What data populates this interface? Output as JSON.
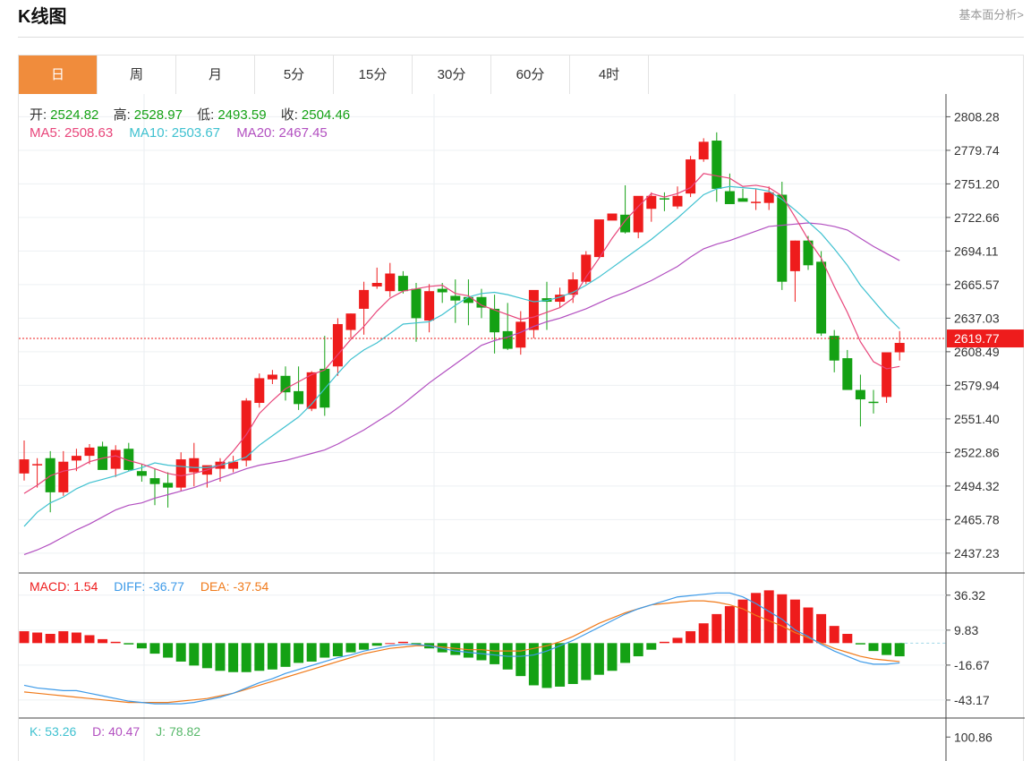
{
  "header": {
    "title": "K线图",
    "link": "基本面分析>"
  },
  "tabs": [
    "日",
    "周",
    "月",
    "5分",
    "15分",
    "30分",
    "60分",
    "4时"
  ],
  "active_tab": 0,
  "ohlc": {
    "open_label": "开:",
    "open": "2524.82",
    "high_label": "高:",
    "high": "2528.97",
    "low_label": "低:",
    "low": "2493.59",
    "close_label": "收:",
    "close": "2504.46"
  },
  "ma": {
    "ma5_label": "MA5:",
    "ma5": "2508.63",
    "ma10_label": "MA10:",
    "ma10": "2503.67",
    "ma20_label": "MA20:",
    "ma20": "2467.45"
  },
  "macd": {
    "macd_label": "MACD:",
    "macd": "1.54",
    "diff_label": "DIFF:",
    "diff": "-36.77",
    "dea_label": "DEA:",
    "dea": "-37.54"
  },
  "kdj": {
    "k_label": "K:",
    "k": "53.26",
    "d_label": "D:",
    "d": "40.47",
    "j_label": "J:",
    "j": "78.82"
  },
  "colors": {
    "up": "#ee1c1c",
    "down": "#14a114",
    "ma5": "#e8457a",
    "ma10": "#3fc1d0",
    "ma20": "#b24fc0",
    "diff": "#3d9ae8",
    "dea": "#f07a1a",
    "tab_active": "#f08c3c"
  },
  "chart_data": [
    {
      "type": "candlestick",
      "title": "",
      "y_ticks": [
        "2808.28",
        "2779.74",
        "2751.20",
        "2722.66",
        "2694.11",
        "2665.57",
        "2637.03",
        "2608.49",
        "2579.94",
        "2551.40",
        "2522.86",
        "2494.32",
        "2465.78",
        "2437.23"
      ],
      "ylim": [
        2428,
        2820
      ],
      "current_price": "2619.77",
      "candles": [
        [
          2505,
          2533,
          2499,
          2517
        ],
        [
          2513,
          2518,
          2493,
          2513
        ],
        [
          2518,
          2524,
          2472,
          2489
        ],
        [
          2489,
          2524,
          2486,
          2515
        ],
        [
          2516,
          2526,
          2507,
          2520
        ],
        [
          2520,
          2530,
          2513,
          2527
        ],
        [
          2528,
          2532,
          2510,
          2508
        ],
        [
          2509,
          2529,
          2502,
          2525
        ],
        [
          2526,
          2531,
          2507,
          2508
        ],
        [
          2507,
          2513,
          2498,
          2503
        ],
        [
          2501,
          2509,
          2478,
          2496
        ],
        [
          2497,
          2506,
          2476,
          2493
        ],
        [
          2493,
          2523,
          2490,
          2517
        ],
        [
          2506,
          2531,
          2494,
          2518
        ],
        [
          2504,
          2508,
          2493,
          2512
        ],
        [
          2509,
          2518,
          2498,
          2515
        ],
        [
          2509,
          2520,
          2506,
          2515
        ],
        [
          2516,
          2569,
          2511,
          2567
        ],
        [
          2565,
          2590,
          2561,
          2586
        ],
        [
          2585,
          2593,
          2581,
          2589
        ],
        [
          2588,
          2596,
          2567,
          2574
        ],
        [
          2575,
          2596,
          2559,
          2564
        ],
        [
          2560,
          2592,
          2558,
          2591
        ],
        [
          2594,
          2622,
          2554,
          2561
        ],
        [
          2596,
          2637,
          2588,
          2632
        ],
        [
          2627,
          2641,
          2620,
          2641
        ],
        [
          2645,
          2668,
          2623,
          2661
        ],
        [
          2664,
          2680,
          2662,
          2667
        ],
        [
          2660,
          2684,
          2655,
          2675
        ],
        [
          2673,
          2677,
          2658,
          2660
        ],
        [
          2662,
          2667,
          2617,
          2637
        ],
        [
          2635,
          2666,
          2625,
          2660
        ],
        [
          2662,
          2667,
          2650,
          2659
        ],
        [
          2656,
          2670,
          2633,
          2652
        ],
        [
          2655,
          2670,
          2631,
          2650
        ],
        [
          2655,
          2662,
          2637,
          2646
        ],
        [
          2645,
          2657,
          2607,
          2625
        ],
        [
          2626,
          2650,
          2610,
          2611
        ],
        [
          2612,
          2643,
          2606,
          2634
        ],
        [
          2627,
          2660,
          2620,
          2661
        ],
        [
          2654,
          2668,
          2627,
          2651
        ],
        [
          2651,
          2663,
          2646,
          2657
        ],
        [
          2657,
          2676,
          2650,
          2670
        ],
        [
          2668,
          2694,
          2666,
          2691
        ],
        [
          2689,
          2698,
          2688,
          2721
        ],
        [
          2720,
          2725,
          2722,
          2726
        ],
        [
          2725,
          2750,
          2709,
          2710
        ],
        [
          2710,
          2730,
          2705,
          2741
        ],
        [
          2730,
          2744,
          2719,
          2741
        ],
        [
          2739,
          2744,
          2728,
          2738
        ],
        [
          2732,
          2749,
          2730,
          2741
        ],
        [
          2743,
          2775,
          2740,
          2772
        ],
        [
          2772,
          2790,
          2770,
          2787
        ],
        [
          2788,
          2795,
          2736,
          2747
        ],
        [
          2745,
          2760,
          2738,
          2734
        ],
        [
          2739,
          2747,
          2738,
          2736
        ],
        [
          2736,
          2747,
          2729,
          2736
        ],
        [
          2735,
          2749,
          2729,
          2744
        ],
        [
          2742,
          2753,
          2661,
          2668
        ],
        [
          2677,
          2703,
          2651,
          2703
        ],
        [
          2703,
          2707,
          2678,
          2682
        ],
        [
          2685,
          2694,
          2622,
          2624
        ],
        [
          2622,
          2627,
          2591,
          2601
        ],
        [
          2603,
          2610,
          2578,
          2576
        ],
        [
          2576,
          2589,
          2545,
          2568
        ],
        [
          2566,
          2576,
          2556,
          2565
        ],
        [
          2570,
          2578,
          2565,
          2608
        ],
        [
          2608,
          2626,
          2601,
          2616
        ]
      ],
      "ma5": [
        2488,
        2495,
        2503,
        2507,
        2509,
        2515,
        2518,
        2520,
        2516,
        2513,
        2509,
        2505,
        2503,
        2505,
        2508,
        2512,
        2524,
        2538,
        2556,
        2567,
        2577,
        2583,
        2589,
        2593,
        2606,
        2619,
        2630,
        2643,
        2654,
        2660,
        2662,
        2664,
        2665,
        2658,
        2656,
        2648,
        2644,
        2640,
        2636,
        2638,
        2642,
        2646,
        2654,
        2672,
        2688,
        2705,
        2720,
        2732,
        2743,
        2740,
        2743,
        2748,
        2760,
        2758,
        2756,
        2749,
        2750,
        2748,
        2741,
        2723,
        2704,
        2688,
        2664,
        2642,
        2617,
        2600,
        2594,
        2596
      ],
      "ma10": [
        2460,
        2472,
        2480,
        2485,
        2492,
        2497,
        2500,
        2503,
        2507,
        2510,
        2514,
        2512,
        2511,
        2510,
        2510,
        2512,
        2515,
        2519,
        2529,
        2537,
        2545,
        2553,
        2564,
        2577,
        2590,
        2602,
        2610,
        2616,
        2624,
        2632,
        2633,
        2634,
        2640,
        2648,
        2655,
        2658,
        2659,
        2657,
        2654,
        2651,
        2652,
        2655,
        2659,
        2665,
        2672,
        2680,
        2688,
        2696,
        2704,
        2713,
        2722,
        2732,
        2742,
        2747,
        2749,
        2748,
        2747,
        2745,
        2738,
        2729,
        2719,
        2709,
        2696,
        2682,
        2665,
        2652,
        2639,
        2628
      ],
      "ma20": [
        2436,
        2440,
        2445,
        2451,
        2457,
        2462,
        2468,
        2474,
        2478,
        2480,
        2484,
        2487,
        2490,
        2493,
        2497,
        2501,
        2505,
        2509,
        2512,
        2514,
        2516,
        2519,
        2522,
        2525,
        2530,
        2536,
        2542,
        2549,
        2556,
        2564,
        2573,
        2582,
        2590,
        2598,
        2606,
        2614,
        2618,
        2621,
        2625,
        2630,
        2634,
        2637,
        2641,
        2645,
        2650,
        2655,
        2659,
        2664,
        2669,
        2675,
        2681,
        2689,
        2696,
        2700,
        2703,
        2707,
        2711,
        2715,
        2716,
        2717,
        2718,
        2717,
        2715,
        2712,
        2705,
        2698,
        2692,
        2686
      ]
    },
    {
      "type": "macd",
      "y_ticks": [
        "36.32",
        "9.83",
        "-16.67",
        "-43.17"
      ],
      "ylim": [
        -50,
        45
      ],
      "histogram": [
        9,
        8,
        7,
        9,
        8,
        6,
        3,
        1,
        -1,
        -4,
        -8,
        -11,
        -14,
        -17,
        -19,
        -21,
        -22,
        -22,
        -21,
        -20,
        -18,
        -15,
        -14,
        -11,
        -10,
        -7,
        -5,
        -2,
        0,
        1,
        -1,
        -4,
        -7,
        -9,
        -11,
        -13,
        -16,
        -20,
        -25,
        -32,
        -34,
        -33,
        -31,
        -28,
        -24,
        -21,
        -15,
        -10,
        -5,
        1,
        4,
        9,
        15,
        22,
        28,
        33,
        38,
        40,
        37,
        33,
        27,
        22,
        13,
        7,
        -1,
        -6,
        -9,
        -10
      ],
      "diff": [
        -32,
        -34,
        -35,
        -36,
        -36,
        -38,
        -40,
        -42,
        -44,
        -45,
        -46,
        -46,
        -46,
        -45,
        -43,
        -41,
        -38,
        -34,
        -30,
        -27,
        -23,
        -20,
        -17,
        -14,
        -11,
        -9,
        -6,
        -4,
        -2,
        -1,
        -1,
        -2,
        -4,
        -6,
        -7,
        -8,
        -9,
        -10,
        -10,
        -9,
        -6,
        -2,
        2,
        7,
        12,
        17,
        22,
        26,
        29,
        32,
        35,
        36,
        37,
        38,
        38,
        35,
        30,
        24,
        18,
        10,
        5,
        -1,
        -6,
        -10,
        -14,
        -16,
        -16,
        -15
      ],
      "dea": [
        -37,
        -38,
        -39,
        -40,
        -41,
        -42,
        -43,
        -44,
        -45,
        -45,
        -45,
        -45,
        -44,
        -43,
        -42,
        -40,
        -38,
        -35,
        -32,
        -29,
        -26,
        -23,
        -20,
        -17,
        -14,
        -11,
        -8,
        -6,
        -4,
        -3,
        -2,
        -2,
        -3,
        -4,
        -5,
        -5,
        -6,
        -6,
        -6,
        -4,
        -2,
        1,
        5,
        10,
        15,
        19,
        23,
        26,
        29,
        30,
        31,
        32,
        32,
        31,
        29,
        26,
        21,
        17,
        13,
        8,
        4,
        0,
        -4,
        -7,
        -10,
        -12,
        -13,
        -14
      ]
    },
    {
      "type": "kdj",
      "y_ticks": [
        "100.86"
      ],
      "ylim": [
        30,
        110
      ]
    }
  ]
}
